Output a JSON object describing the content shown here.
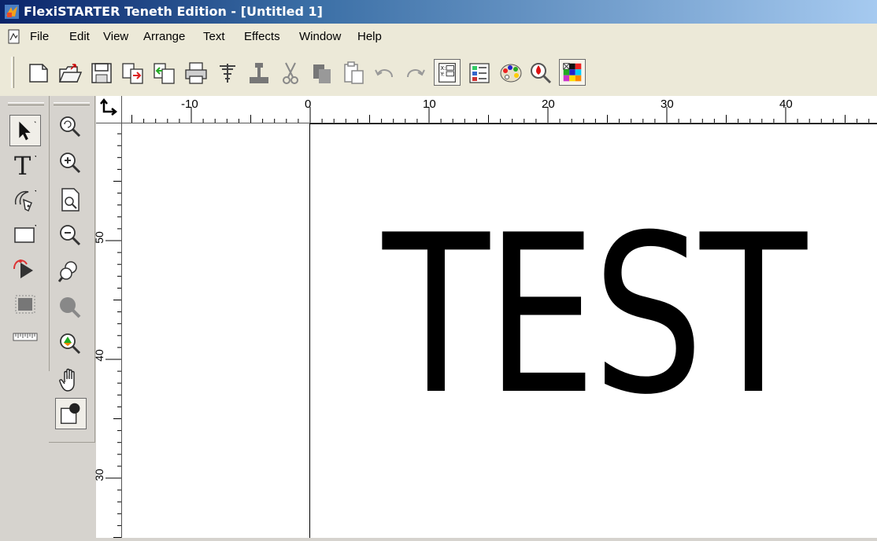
{
  "window": {
    "title": "FlexiSTARTER Teneth Edition - [Untitled 1]"
  },
  "menu": [
    "File",
    "Edit",
    "View",
    "Arrange",
    "Text",
    "Effects",
    "Window",
    "Help"
  ],
  "toolbar": {
    "buttons": [
      "new-document",
      "open",
      "save",
      "import",
      "export",
      "print",
      "cut-plot",
      "production-manager",
      "cut",
      "copy",
      "paste",
      "undo",
      "redo",
      "position-size",
      "layout-view",
      "color-palette",
      "spot-color",
      "color-swatch"
    ]
  },
  "tools": {
    "main": [
      "select-arrow",
      "text",
      "pen",
      "rectangle",
      "shape-edit",
      "fill",
      "measure"
    ],
    "zoom": [
      "zoom-previous",
      "zoom-in",
      "zoom-page",
      "zoom-out",
      "zoom-selection",
      "zoom-all",
      "zoom-color",
      "pan-hand",
      "fill-stroke"
    ]
  },
  "ruler": {
    "horizontal": [
      "-10",
      "0",
      "10",
      "20",
      "30",
      "40"
    ],
    "vertical": [
      "50",
      "40",
      "30"
    ]
  },
  "canvas": {
    "text": "TEST"
  }
}
